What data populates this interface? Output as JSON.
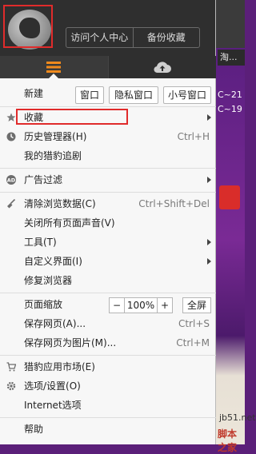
{
  "background": {
    "tab_label": "淘...",
    "text_1": "C~21",
    "text_2": "C~19",
    "watermark_1": "jb51.net",
    "watermark_2": "脚本之家"
  },
  "header": {
    "visit_center": "访问个人中心",
    "backup_favorites": "备份收藏"
  },
  "menu": {
    "new_label": "新建",
    "new_window": "窗口",
    "new_private": "隐私窗口",
    "new_small": "小号窗口",
    "favorites": "收藏",
    "history": "历史管理器",
    "history_key": "(H)",
    "history_shortcut": "Ctrl+H",
    "my_cheetah": "我的猎豹追剧",
    "ad_filter": "广告过滤",
    "clear_data": "清除浏览数据(C)",
    "clear_shortcut": "Ctrl+Shift+Del",
    "mute_all": "关闭所有页面声音(V)",
    "tools": "工具(T)",
    "custom_ui": "自定义界面(I)",
    "repair": "修复浏览器",
    "zoom_label": "页面缩放",
    "zoom_minus": "−",
    "zoom_value": "100%",
    "zoom_plus": "+",
    "fullscreen": "全屏",
    "save_page": "保存网页(A)...",
    "save_shortcut": "Ctrl+S",
    "save_image": "保存网页为图片(M)...",
    "save_image_shortcut": "Ctrl+M",
    "app_market": "猎豹应用市场(E)",
    "options": "选项/设置(O)",
    "internet_options": "Internet选项",
    "help": "帮助"
  },
  "colors": {
    "accent": "#f08a1c",
    "highlight_box": "#e02b2b"
  }
}
